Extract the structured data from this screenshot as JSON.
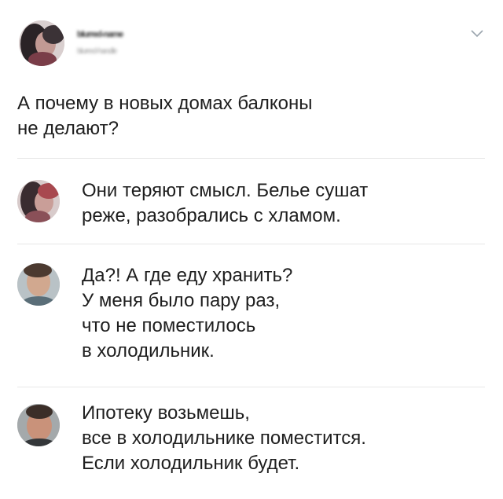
{
  "post": {
    "author_name": "blurred-name",
    "author_handle": "blurred-handle",
    "text": "А почему в новых домах балконы\nне делают?"
  },
  "replies": [
    {
      "text": "Они теряют смысл. Белье сушат\nреже, разобрались с хламом."
    },
    {
      "text": "Да?! А где еду хранить?\nУ меня было пару раз,\nчто не поместилось\nв холодильник."
    },
    {
      "text": "Ипотеку возьмешь,\nвсе в холодильнике поместится.\nЕсли холодильник будет."
    }
  ],
  "icons": {
    "menu": "chevron-down-icon"
  },
  "colors": {
    "text": "#1e1e1e",
    "divider": "#e7e7e7",
    "chevron": "#9aa4ad"
  }
}
